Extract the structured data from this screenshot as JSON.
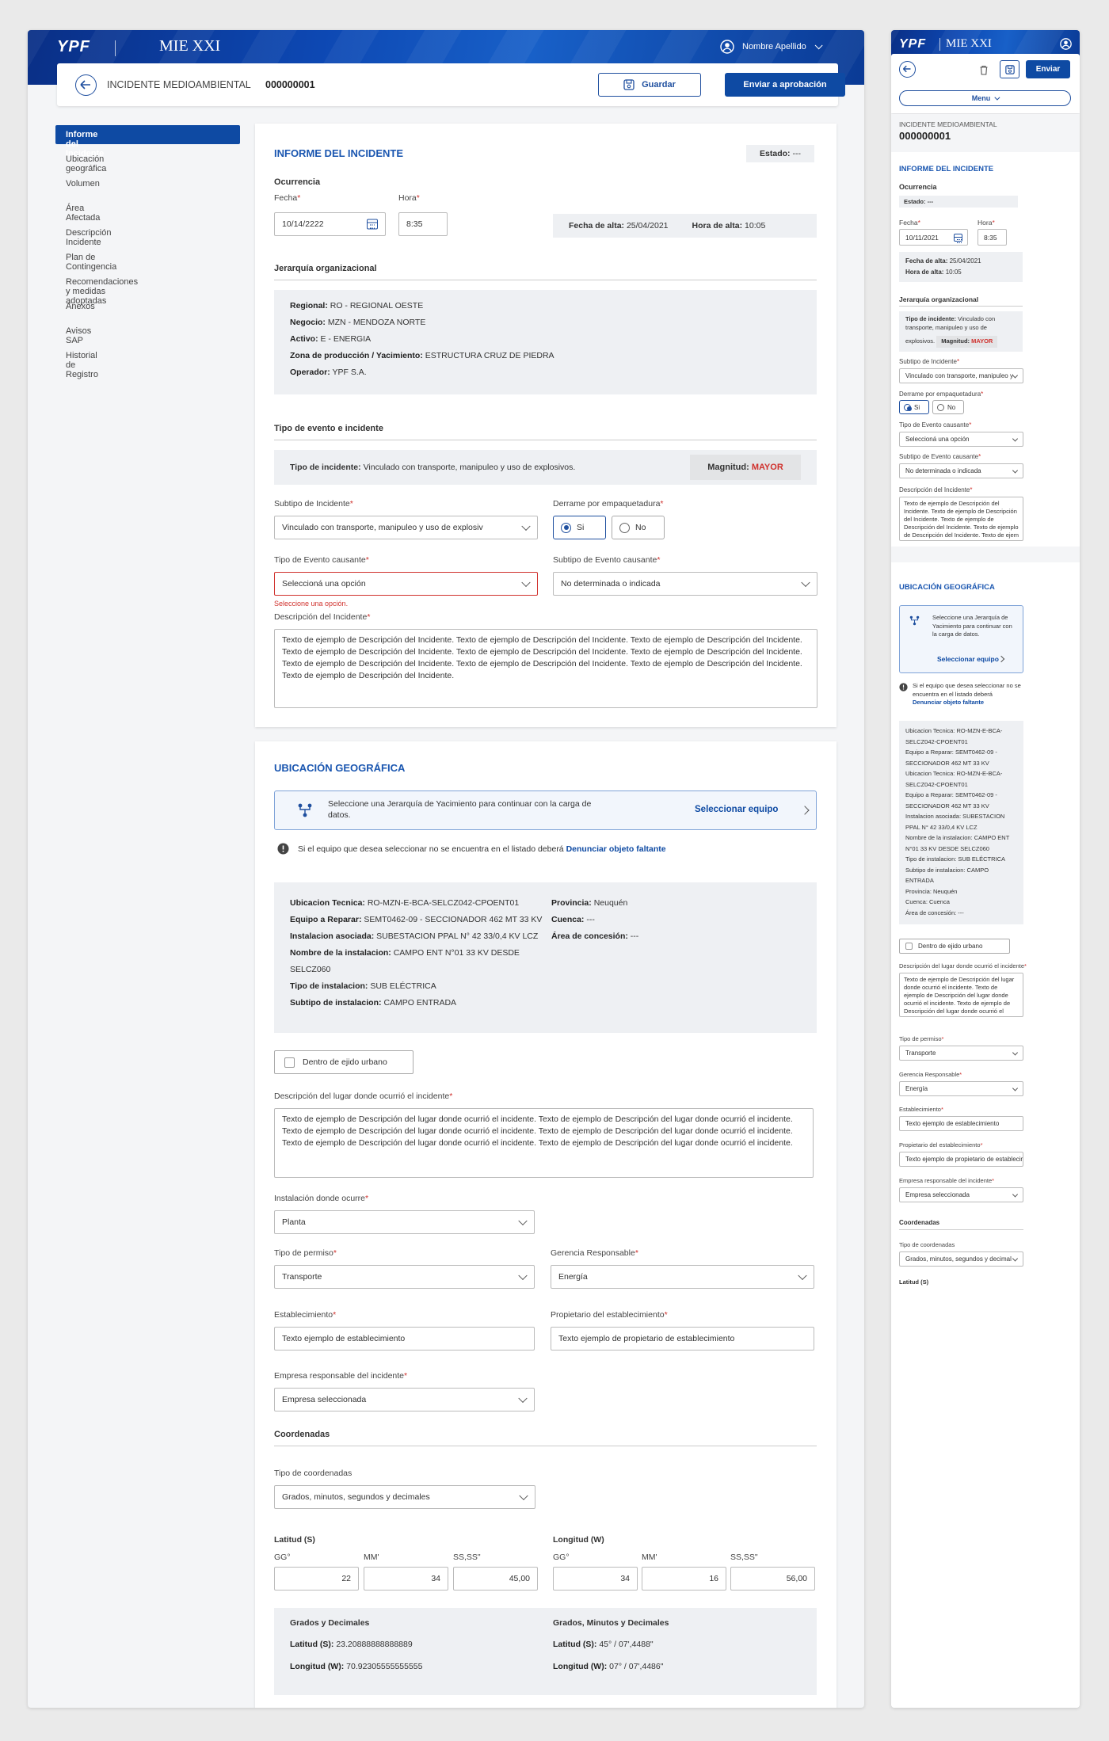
{
  "brand": {
    "logo": "YPF",
    "app_name": "MIE XXI",
    "user_name": "Nombre Apellido"
  },
  "header": {
    "page_label": "INCIDENTE MEDIOAMBIENTAL",
    "id": "000000001",
    "save": "Guardar",
    "send": "Enviar a aprobación"
  },
  "sidebar": {
    "items": [
      "Informe del Incidente",
      "Ubicación geográfica",
      "Volumen",
      "Área Afectada",
      "Descripción Incidente",
      "Plan de Contingencia",
      "Recomendaciones y medidas adoptadas",
      "Anexos",
      "Avisos SAP",
      "Historial de Registro"
    ]
  },
  "informe": {
    "title": "INFORME DEL INCIDENTE",
    "estado_label": "Estado:",
    "estado_value": "---",
    "ocurrencia": "Ocurrencia",
    "fecha_label": "Fecha",
    "fecha_value": "10/14/2222",
    "hora_label": "Hora",
    "hora_value": "8:35",
    "fecha_alta_label": "Fecha de alta:",
    "fecha_alta_value": "25/04/2021",
    "hora_alta_label": "Hora de alta:",
    "hora_alta_value": "10:05",
    "jerarquia_title": "Jerarquía organizacional",
    "jerarquia": [
      {
        "label": "Regional:",
        "value": "RO - REGIONAL OESTE"
      },
      {
        "label": "Negocio:",
        "value": "MZN - MENDOZA NORTE"
      },
      {
        "label": "Activo:",
        "value": "E - ENERGIA"
      },
      {
        "label": "Zona de producción / Yacimiento:",
        "value": "ESTRUCTURA CRUZ DE PIEDRA"
      },
      {
        "label": "Operador:",
        "value": "YPF S.A."
      }
    ],
    "tipo_evento_title": "Tipo de evento e incidente",
    "tipo_incidente_label": "Tipo de incidente:",
    "tipo_incidente_value": "Vinculado con transporte, manipuleo y uso de explosivos.",
    "magnitud_label": "Magnitud:",
    "magnitud_value": "MAYOR",
    "subtipo_label": "Subtipo de Incidente",
    "subtipo_value": "Vinculado con transporte, manipuleo y uso de explosiv",
    "derrame_label": "Derrame por empaquetadura",
    "si": "Si",
    "no": "No",
    "tipo_causante_label": "Tipo de Evento causante",
    "tipo_causante_value": "Seleccioná una opción",
    "tipo_causante_error": "Seleccione una opción.",
    "subtipo_causante_label": "Subtipo de Evento causante",
    "subtipo_causante_value": "No determinada o indicada",
    "descripcion_label": "Descripción del Incidente",
    "descripcion_value": "Texto de ejemplo de Descripción del Incidente. Texto de ejemplo de Descripción del Incidente. Texto de ejemplo de Descripción del Incidente. Texto de ejemplo de Descripción del Incidente. Texto de ejemplo de Descripción del Incidente. Texto de ejemplo de Descripción del Incidente. Texto de ejemplo de Descripción del Incidente. Texto de ejemplo de Descripción del Incidente. Texto de ejemplo de Descripción del Incidente. Texto de ejemplo de Descripción del Incidente."
  },
  "ubicacion": {
    "title": "UBICACIÓN GEOGRÁFICA",
    "banner_text": "Seleccione una Jerarquía de Yacimiento para continuar con la carga de datos.",
    "banner_link": "Seleccionar equipo",
    "warning_text": "Si el equipo que desea seleccionar no se encuentra en el listado deberá",
    "warning_link": "Denunciar objeto faltante",
    "info_left": [
      {
        "label": "Ubicacion Tecnica:",
        "value": "RO-MZN-E-BCA-SELCZ042-CPOENT01"
      },
      {
        "label": "Equipo a Reparar:",
        "value": "SEMT0462-09 - SECCIONADOR 462 MT 33 KV"
      },
      {
        "label": "Instalacion asociada:",
        "value": "SUBESTACION PPAL N° 42 33/0,4 KV LCZ"
      },
      {
        "label": "Nombre de la instalacion:",
        "value": "CAMPO ENT N°01 33 KV DESDE"
      },
      {
        "label": "",
        "value": "SELCZ060"
      },
      {
        "label": "Tipo de instalacion:",
        "value": "SUB ELÉCTRICA"
      },
      {
        "label": "Subtipo de instalacion:",
        "value": "CAMPO ENTRADA"
      }
    ],
    "info_right": [
      {
        "label": "Provincia:",
        "value": "Neuquén"
      },
      {
        "label": "Cuenca:",
        "value": "---"
      },
      {
        "label": "Área de concesión:",
        "value": "---"
      }
    ],
    "ejido": "Dentro de ejido urbano",
    "desc_lugar_label": "Descripción del lugar donde ocurrió el incidente",
    "desc_lugar_value": "Texto de ejemplo de Descripción del lugar donde ocurrió el incidente. Texto de ejemplo de Descripción del lugar donde ocurrió el incidente. Texto de ejemplo de Descripción del lugar donde ocurrió el incidente. Texto de ejemplo de Descripción del lugar donde ocurrió el incidente. Texto de ejemplo de Descripción del lugar donde ocurrió el incidente. Texto de ejemplo de Descripción del lugar donde ocurrió el incidente.",
    "instalacion_label": "Instalación donde ocurre",
    "instalacion_value": "Planta",
    "permiso_label": "Tipo de permiso",
    "permiso_value": "Transporte",
    "gerencia_label": "Gerencia Responsable",
    "gerencia_value": "Energía",
    "establecimiento_label": "Establecimiento",
    "establecimiento_value": "Texto ejemplo de establecimiento",
    "propietario_label": "Propietario del establecimiento",
    "propietario_value": "Texto ejemplo de propietario de establecimiento",
    "empresa_label": "Empresa responsable del incidente",
    "empresa_value": "Empresa seleccionada",
    "coordenadas_title": "Coordenadas",
    "tipo_coord_label": "Tipo de coordenadas",
    "tipo_coord_value": "Grados, minutos, segundos y decimales",
    "latitud_title": "Latitud (S)",
    "longitud_title": "Longitud (W)",
    "gg": "GG°",
    "mm": "MM'",
    "ss": "SS,SS\"",
    "lat_gg": "22",
    "lat_mm": "34",
    "lat_ss": "45,00",
    "lon_gg": "34",
    "lon_mm": "16",
    "lon_ss": "56,00",
    "gd_title": "Grados y Decimales",
    "gmd_title": "Grados, Minutos y Decimales",
    "gd_lat_label": "Latitud (S):",
    "gd_lat_value": "23.20888888888889",
    "gd_lon_label": "Longitud (W):",
    "gd_lon_value": "70.92305555555555",
    "gmd_lat_label": "Latitud (S):",
    "gmd_lat_value": "45° / 07',4488\"",
    "gmd_lon_label": "Longitud (W):",
    "gmd_lon_value": "07° / 07',4486\""
  },
  "mobile": {
    "send": "Enviar",
    "menu": "Menu",
    "label": "INCIDENTE MEDIOAMBIENTAL",
    "id": "000000001",
    "title": "INFORME DEL INCIDENTE",
    "ocurrencia": "Ocurrencia",
    "estado": "Estado: ---",
    "fecha_label": "Fecha",
    "fecha_value": "10/11/2021",
    "hora_label": "Hora",
    "hora_value": "8:35",
    "fecha_alta": "Fecha de alta:",
    "fecha_alta_value": "25/04/2021",
    "hora_alta": "Hora de alta:",
    "hora_alta_value": "10:05",
    "jerarquia": "Jerarquía organizacional",
    "tipo_incidente_label": "Tipo de incidente:",
    "tipo_incidente_value": "Vinculado con transporte, manipuleo y uso de explosivos.",
    "magnitud_label": "Magnitud:",
    "magnitud_value": "MAYOR",
    "subtipo_label": "Subtipo de Incidente",
    "subtipo_value": "Vinculado con transporte, manipuleo y",
    "derrame_label": "Derrame por empaquetadura",
    "si": "Si",
    "no": "No",
    "tipo_causante_label": "Tipo de Evento causante",
    "tipo_causante_value": "Seleccioná una opción",
    "subtipo_causante_label": "Subtipo de Evento causante",
    "subtipo_causante_value": "No determinada o indicada",
    "descripcion_label": "Descripción del Incidente",
    "descripcion_value": "Texto de ejemplo de Descripción del Incidente. Texto de ejemplo de Descripción del Incidente. Texto de ejemplo de Descripción del Incidente. Texto de ejemplo de Descripción del Incidente. Texto de ejem",
    "ubic_title": "UBICACIÓN GEOGRÁFICA",
    "banner_text": "Seleccione una Jerarquía de Yacimiento para continuar con la carga de datos.",
    "banner_link": "Seleccionar equipo",
    "warning_text": "Si el equipo que desea seleccionar no se encuentra en el listado deberá",
    "warning_link": "Denunciar objeto faltante",
    "info": [
      "Ubicacion Tecnica: RO-MZN-E-BCA-SELCZ042-CPOENT01",
      "Equipo a Reparar: SEMT0462-09 - SECCIONADOR 462 MT 33 KV",
      "Ubicacion Tecnica: RO-MZN-E-BCA-SELCZ042-CPOENT01",
      "Equipo a Reparar: SEMT0462-09 - SECCIONADOR 462 MT 33 KV",
      "Instalacion asociada: SUBESTACION PPAL N° 42 33/0,4 KV LCZ",
      "Nombre de la instalacion: CAMPO ENT N°01 33 KV DESDE SELCZ060",
      "Tipo de instalacion: SUB ELÉCTRICA",
      "Subtipo de instalacion: CAMPO ENTRADA",
      "Provincia: Neuquén",
      "Cuenca: Cuenca",
      "Área de concesión: ---"
    ],
    "ejido": "Dentro de ejido urbano",
    "desc_lugar_label": "Descripción del lugar donde ocurrió el incidente",
    "desc_lugar_value": "Texto de ejemplo de Descripción del lugar donde ocurrió el incidente. Texto de ejemplo de Descripción del lugar donde ocurrió el incidente. Texto de ejemplo de Descripción del lugar donde ocurrió el",
    "permiso_label": "Tipo de permiso",
    "permiso_value": "Transporte",
    "gerencia_label": "Gerencia Responsable",
    "gerencia_value": "Energía",
    "establecimiento_label": "Establecimiento",
    "establecimiento_value": "Texto ejemplo de establecimiento",
    "propietario_label": "Propietario del establecimiento",
    "propietario_value": "Texto ejemplo de propietario de establecimie",
    "empresa_label": "Empresa responsable del incidente",
    "empresa_value": "Empresa seleccionada",
    "coordenadas": "Coordenadas",
    "tipo_coord_label": "Tipo de coordenadas",
    "tipo_coord_value": "Grados, minutos, segundos y decimal",
    "latitud_cut": "Latitud (S)"
  },
  "colors": {
    "brand_blue": "#0e4aa3",
    "title_blue": "#1a56b0",
    "error_red": "#d0312d",
    "panel_grey": "#eef0f3"
  }
}
